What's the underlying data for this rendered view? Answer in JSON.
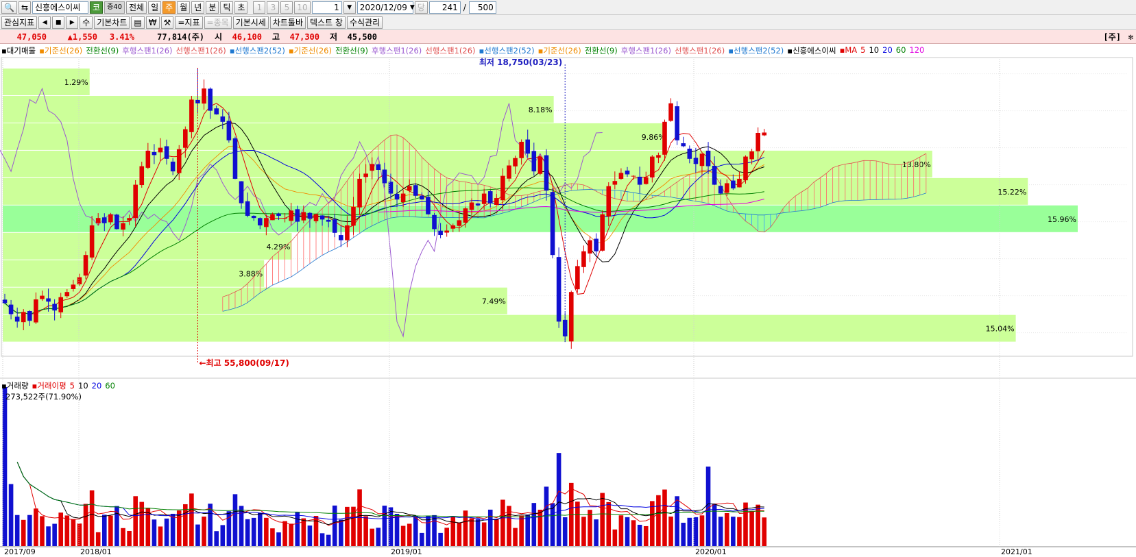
{
  "toolbar1": {
    "stock_name": "신흥에스이씨",
    "market_badge": "코",
    "period_badge": "증40",
    "periods": [
      "전체",
      "일",
      "주",
      "월",
      "년",
      "분",
      "틱",
      "초"
    ],
    "selected_period": "주",
    "intervals": [
      "1",
      "3",
      "5",
      "10"
    ],
    "interval_value": "1",
    "date_value": "2020/12/09",
    "dang_label": "당",
    "count_value": "241",
    "count_sep": "/",
    "count_total": "500"
  },
  "toolbar2": {
    "buttons": [
      "관심지표",
      "기본차트",
      "=지표",
      "=종목",
      "기본시세",
      "차트툴바",
      "텍스트 창",
      "수식관리"
    ],
    "nav_su": "수"
  },
  "info": {
    "price": "47,050",
    "change": "▲1,550",
    "rate": "3.41%",
    "volume": "77,814(주)",
    "open_label": "시",
    "open": "46,100",
    "high_label": "고",
    "high": "47,300",
    "low_label": "저",
    "low": "45,500",
    "right_label": "[주]"
  },
  "legend": [
    {
      "text": "▪대기매물",
      "color": "#000000"
    },
    {
      "text": "▪기준선(26)",
      "color": "#f08c00"
    },
    {
      "text": "전환선(9)",
      "color": "#008000"
    },
    {
      "text": "후행스팬1(26)",
      "color": "#9b59d0"
    },
    {
      "text": "선행스팬1(26)",
      "color": "#e05050"
    },
    {
      "text": "▪선행스팬2(52)",
      "color": "#1e78d0"
    },
    {
      "text": "▪기준선(26)",
      "color": "#f08c00"
    },
    {
      "text": "전환선(9)",
      "color": "#008000"
    },
    {
      "text": "후행스팬1(26)",
      "color": "#9b59d0"
    },
    {
      "text": "선행스팬1(26)",
      "color": "#e05050"
    },
    {
      "text": "▪선행스팬2(52)",
      "color": "#1e78d0"
    },
    {
      "text": "▪기준선(26)",
      "color": "#f08c00"
    },
    {
      "text": "전환선(9)",
      "color": "#008000"
    },
    {
      "text": "후행스팬1(26)",
      "color": "#9b59d0"
    },
    {
      "text": "선행스팬1(26)",
      "color": "#e05050"
    },
    {
      "text": "▪선행스팬2(52)",
      "color": "#1e78d0"
    },
    {
      "text": "▪신흥에스이씨",
      "color": "#000000"
    },
    {
      "text": "▪MA",
      "color": "#e00000"
    },
    {
      "text": "5",
      "color": "#e00000"
    },
    {
      "text": "10",
      "color": "#000000"
    },
    {
      "text": "20",
      "color": "#0000e0"
    },
    {
      "text": "60",
      "color": "#008000"
    },
    {
      "text": "120",
      "color": "#e000e0"
    }
  ],
  "volume_legend": [
    {
      "text": "▪거래량",
      "color": "#000000"
    },
    {
      "text": "▪거래이평",
      "color": "#e00000"
    },
    {
      "text": "5",
      "color": "#e00000"
    },
    {
      "text": "10",
      "color": "#000000"
    },
    {
      "text": "20",
      "color": "#0000e0"
    },
    {
      "text": "60",
      "color": "#008000"
    }
  ],
  "volume_sub": "273,522주(71.90%)",
  "annotations": {
    "low": "최저 18,750(03/23)",
    "high": "←최고 55,800(09/17)"
  },
  "colors": {
    "up": "#e00000",
    "down": "#1010d0",
    "overhang": "#ccff99",
    "overhang_max": "#99ff99",
    "cloud_red": "#ff6666",
    "cloud_blue": "#3399ff"
  },
  "chart_data": {
    "type": "candlestick",
    "period": "weekly",
    "x_tick_labels": [
      "2017/09",
      "2018/01",
      "2019/01",
      "2020/01",
      "2021/01"
    ],
    "price_range": [
      17000,
      57000
    ],
    "overhang_labels": [
      "1.29%",
      "8.18%",
      "9.86%",
      "13.80%",
      "15.22%",
      "15.96%",
      "4.29%",
      "3.88%",
      "7.49%",
      "15.04%"
    ],
    "overhang_levels": [
      {
        "low": 52000,
        "high": 55700,
        "pct": 1.29
      },
      {
        "low": 48300,
        "high": 52000,
        "pct": 8.18
      },
      {
        "low": 44600,
        "high": 48300,
        "pct": 9.86
      },
      {
        "low": 40900,
        "high": 44600,
        "pct": 13.8
      },
      {
        "low": 37200,
        "high": 40900,
        "pct": 15.22
      },
      {
        "low": 33500,
        "high": 37200,
        "pct": 15.96
      },
      {
        "low": 29800,
        "high": 33500,
        "pct": 4.29
      },
      {
        "low": 26100,
        "high": 29800,
        "pct": 3.88
      },
      {
        "low": 22400,
        "high": 26100,
        "pct": 7.49
      },
      {
        "low": 18700,
        "high": 22400,
        "pct": 15.04
      }
    ],
    "close_path": [
      24000,
      22500,
      21500,
      22800,
      21600,
      24500,
      25000,
      24200,
      23000,
      24800,
      25500,
      26500,
      27500,
      30500,
      34500,
      35500,
      34800,
      36000,
      34000,
      34800,
      35500,
      40000,
      42500,
      44600,
      44000,
      45000,
      43500,
      41800,
      44800,
      47500,
      51500,
      51000,
      53000,
      50000,
      49500,
      48500,
      46000,
      40800,
      37500,
      35800,
      35500,
      34500,
      35500,
      36000,
      35800,
      35500,
      36500,
      35000,
      36300,
      35400,
      36000,
      35300,
      35000,
      33500,
      32500,
      34500,
      37000,
      40800,
      41500,
      42800,
      42000,
      40200,
      38800,
      38000,
      38800,
      39800,
      38500,
      38000,
      36000,
      34000,
      33200,
      33800,
      34500,
      35200,
      36800,
      37600,
      37200,
      38800,
      37500,
      38200,
      41200,
      42600,
      43600,
      45800,
      44200,
      41800,
      43800,
      39200,
      30500,
      21500,
      18750,
      25500,
      29000,
      31000,
      32500,
      31000,
      36000,
      39800,
      40500,
      41600,
      41400,
      41200,
      40000,
      41000,
      43800,
      44000,
      48500,
      51000,
      46000,
      45200,
      43500,
      42800,
      44200,
      42500,
      40000,
      38800,
      40200,
      39500,
      40800,
      43800,
      44500,
      47000,
      47050
    ],
    "volume_max": 273522
  }
}
